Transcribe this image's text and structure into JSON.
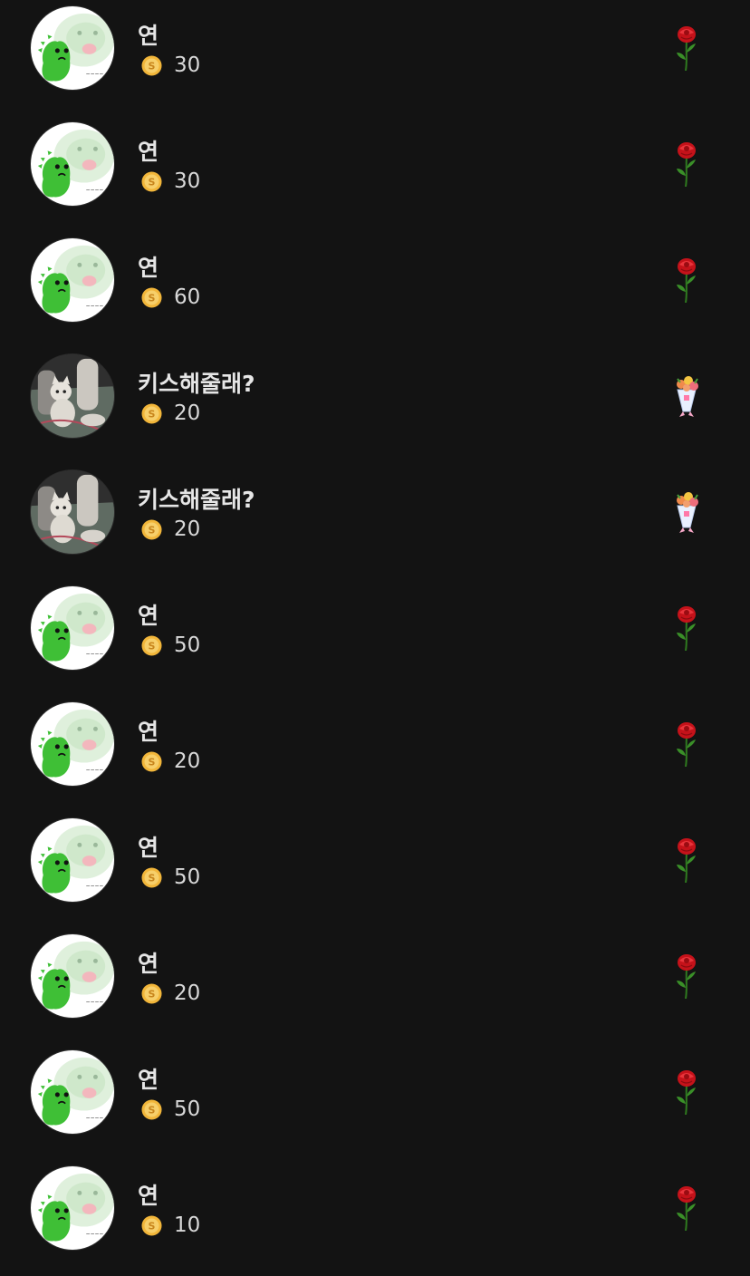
{
  "gifts": [
    {
      "name": "연",
      "amount": "30",
      "avatar": "dino-avatar",
      "gift": "rose"
    },
    {
      "name": "연",
      "amount": "30",
      "avatar": "dino-avatar",
      "gift": "rose"
    },
    {
      "name": "연",
      "amount": "60",
      "avatar": "dino-avatar",
      "gift": "rose"
    },
    {
      "name": "키스해줄래?",
      "amount": "20",
      "avatar": "cat-avatar",
      "gift": "bouquet"
    },
    {
      "name": "키스해줄래?",
      "amount": "20",
      "avatar": "cat-avatar",
      "gift": "bouquet"
    },
    {
      "name": "연",
      "amount": "50",
      "avatar": "dino-avatar",
      "gift": "rose"
    },
    {
      "name": "연",
      "amount": "20",
      "avatar": "dino-avatar",
      "gift": "rose"
    },
    {
      "name": "연",
      "amount": "50",
      "avatar": "dino-avatar",
      "gift": "rose"
    },
    {
      "name": "연",
      "amount": "20",
      "avatar": "dino-avatar",
      "gift": "rose"
    },
    {
      "name": "연",
      "amount": "50",
      "avatar": "dino-avatar",
      "gift": "rose"
    },
    {
      "name": "연",
      "amount": "10",
      "avatar": "dino-avatar",
      "gift": "rose"
    }
  ],
  "colors": {
    "background": "#131313",
    "coin": "#f2b63a",
    "rose": "#d3161b",
    "dino": "#3fbf36"
  }
}
